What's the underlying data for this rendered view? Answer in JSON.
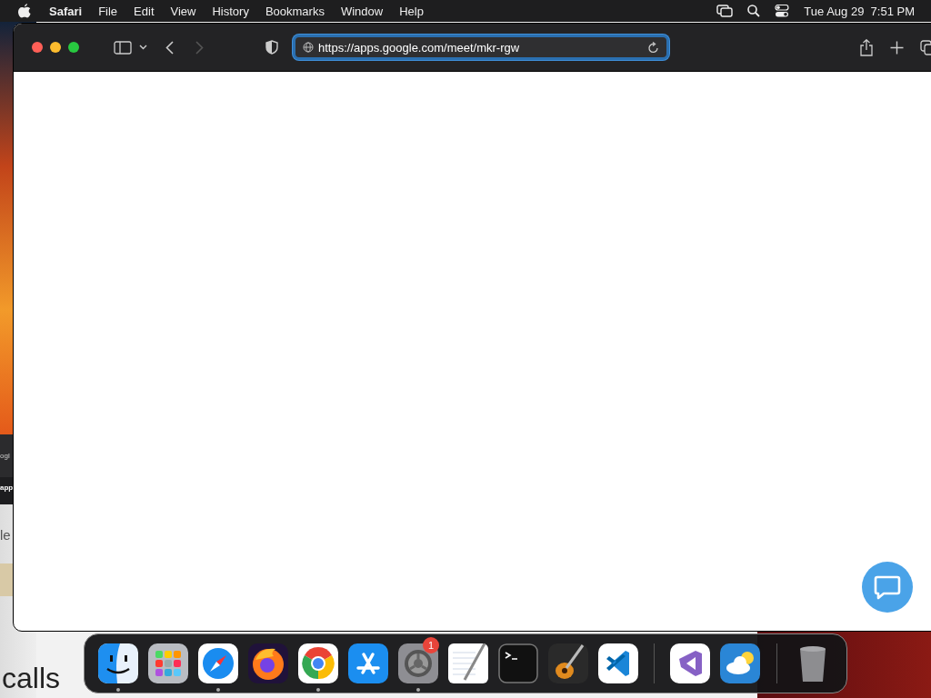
{
  "menu_bar": {
    "app_name": "Safari",
    "menus": [
      "File",
      "Edit",
      "View",
      "History",
      "Bookmarks",
      "Window",
      "Help"
    ],
    "clock": "Tue Aug 29  7:51 PM"
  },
  "background_page": {
    "texts": [
      "ogl",
      "app",
      "le",
      "calls"
    ]
  },
  "browser": {
    "url": "https://apps.google.com/meet/mkr-rgw",
    "url_focused": true,
    "forward_disabled": true
  },
  "dock": {
    "items": [
      {
        "kind": "finder",
        "running": true
      },
      {
        "kind": "launchpad",
        "running": false
      },
      {
        "kind": "safari",
        "running": true
      },
      {
        "kind": "firefox",
        "running": false
      },
      {
        "kind": "chrome",
        "running": true
      },
      {
        "kind": "appstore",
        "running": false
      },
      {
        "kind": "settings",
        "running": true,
        "badge": "1"
      },
      {
        "kind": "textedit",
        "running": false
      },
      {
        "kind": "terminal",
        "running": false
      },
      {
        "kind": "garageband",
        "running": false
      },
      {
        "kind": "vscode",
        "running": false
      },
      {
        "kind": "separator"
      },
      {
        "kind": "visualstudio",
        "running": false
      },
      {
        "kind": "weather",
        "running": false
      },
      {
        "kind": "separator"
      },
      {
        "kind": "trash",
        "running": false
      }
    ]
  }
}
